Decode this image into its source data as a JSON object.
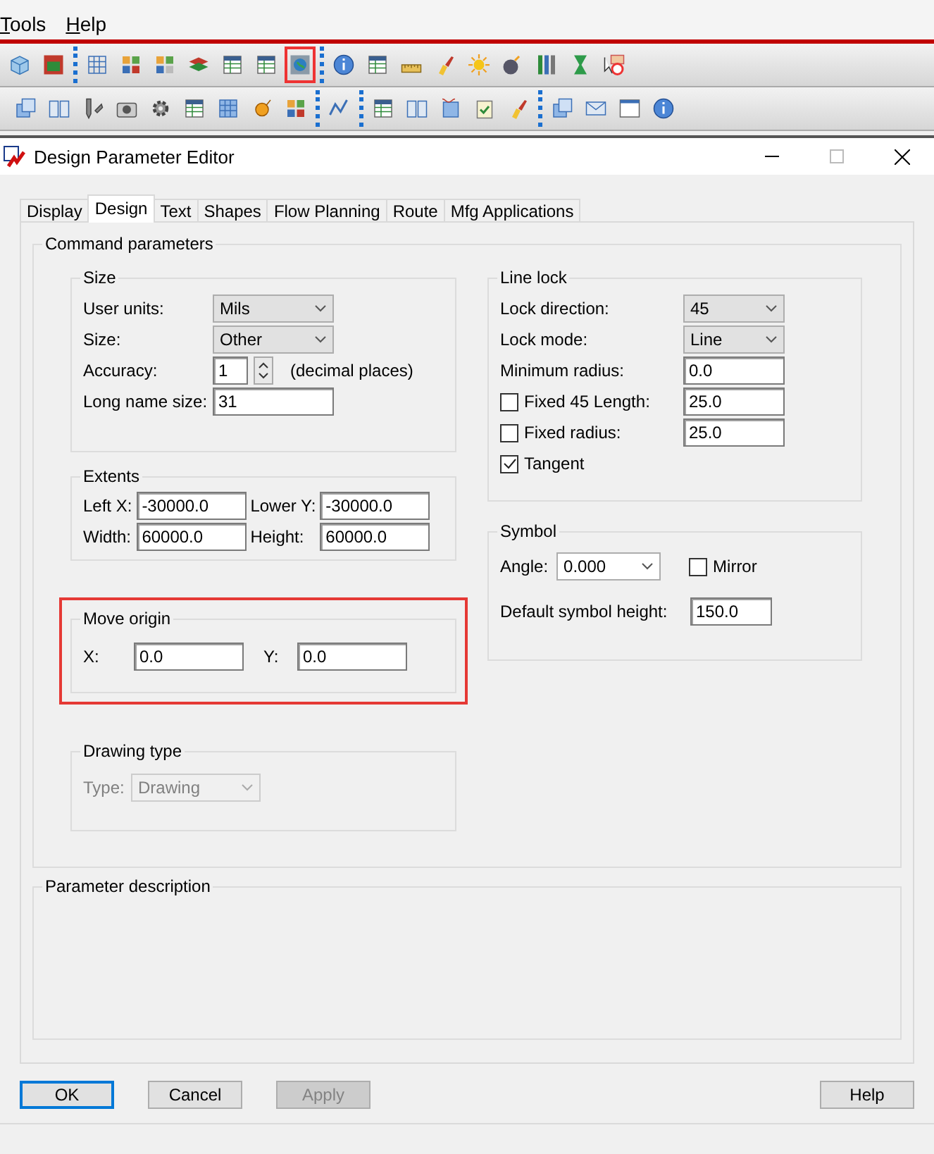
{
  "menu": [
    {
      "label": "Tools"
    },
    {
      "label": "Help"
    }
  ],
  "toolbars": [
    [
      [
        {
          "highlighted": false
        },
        {
          "highlighted": false
        }
      ],
      [
        {
          "highlighted": false
        },
        {
          "highlighted": false
        },
        {
          "highlighted": false
        },
        {
          "highlighted": false
        },
        {
          "highlighted": false
        },
        {
          "highlighted": false
        },
        {
          "highlighted": true
        }
      ],
      [
        {
          "highlighted": false
        },
        {
          "highlighted": false
        },
        {
          "highlighted": false
        },
        {
          "highlighted": false
        },
        {
          "highlighted": false
        },
        {
          "highlighted": false
        },
        {
          "highlighted": false
        },
        {
          "highlighted": false
        },
        {
          "highlighted": false
        }
      ]
    ],
    [
      [
        {
          "highlighted": false
        },
        {
          "highlighted": false
        },
        {
          "highlighted": false
        },
        {
          "highlighted": false
        },
        {
          "highlighted": false
        },
        {
          "highlighted": false
        },
        {
          "highlighted": false
        },
        {
          "highlighted": false
        },
        {
          "highlighted": false
        }
      ],
      [
        {
          "highlighted": false
        }
      ],
      [
        {
          "highlighted": false
        },
        {
          "highlighted": false
        },
        {
          "highlighted": false
        },
        {
          "highlighted": false
        },
        {
          "highlighted": false
        }
      ],
      [
        {
          "highlighted": false
        },
        {
          "highlighted": false
        },
        {
          "highlighted": false
        },
        {
          "highlighted": false
        }
      ]
    ]
  ],
  "window": {
    "title": "Design Parameter Editor"
  },
  "tabs": [
    {
      "label": "Display",
      "selected": false
    },
    {
      "label": "Design",
      "selected": true
    },
    {
      "label": "Text",
      "selected": false
    },
    {
      "label": "Shapes",
      "selected": false
    },
    {
      "label": "Flow Planning",
      "selected": false
    },
    {
      "label": "Route",
      "selected": false
    },
    {
      "label": "Mfg Applications",
      "selected": false
    }
  ],
  "command_parameters": {
    "title": "Command parameters",
    "size": {
      "title": "Size",
      "rows": [
        {
          "kind": "combo",
          "label": "User units:",
          "value": "Mils",
          "disabled": false
        },
        {
          "kind": "combo",
          "label": "Size:",
          "value": "Other",
          "disabled": false
        },
        {
          "kind": "spin",
          "label": "Accuracy:",
          "value": "1",
          "note": "(decimal places)"
        },
        {
          "kind": "input",
          "label": "Long name size:",
          "value": "31"
        }
      ]
    },
    "extents": {
      "title": "Extents",
      "fields": [
        {
          "label": "Left X:",
          "value": "-30000.0"
        },
        {
          "label": "Lower Y:",
          "value": "-30000.0"
        },
        {
          "label": "Width:",
          "value": "60000.0"
        },
        {
          "label": "Height:",
          "value": "60000.0"
        }
      ]
    },
    "move_origin": {
      "title": "Move origin",
      "highlighted": true,
      "fields": [
        {
          "label": "X:",
          "value": "0.0"
        },
        {
          "label": "Y:",
          "value": "0.0"
        }
      ]
    },
    "drawing_type": {
      "title": "Drawing type",
      "rows": [
        {
          "kind": "combo",
          "label": "Type:",
          "value": "Drawing",
          "disabled": true
        }
      ]
    },
    "line_lock": {
      "title": "Line lock",
      "rows": [
        {
          "kind": "combo",
          "label": "Lock direction:",
          "value": "45",
          "disabled": false
        },
        {
          "kind": "combo",
          "label": "Lock mode:",
          "value": "Line",
          "disabled": false
        },
        {
          "kind": "input",
          "label": "Minimum radius:",
          "value": "0.0"
        },
        {
          "kind": "check_input",
          "label": "Fixed 45 Length:",
          "checked": false,
          "value": "25.0"
        },
        {
          "kind": "check_input",
          "label": "Fixed radius:",
          "checked": false,
          "value": "25.0"
        },
        {
          "kind": "check",
          "label": "Tangent",
          "checked": true
        }
      ]
    },
    "symbol": {
      "title": "Symbol",
      "angle_label": "Angle:",
      "angle_value": "0.000",
      "mirror": {
        "label": "Mirror",
        "checked": false
      },
      "height_label": "Default symbol height:",
      "height_value": "150.0"
    }
  },
  "parameter_description": {
    "title": "Parameter description"
  },
  "buttons": [
    {
      "label": "OK",
      "default": true,
      "disabled": false
    },
    {
      "label": "Cancel",
      "default": false,
      "disabled": false
    },
    {
      "label": "Apply",
      "default": false,
      "disabled": true
    },
    {
      "label": "Help",
      "default": false,
      "disabled": false
    }
  ]
}
